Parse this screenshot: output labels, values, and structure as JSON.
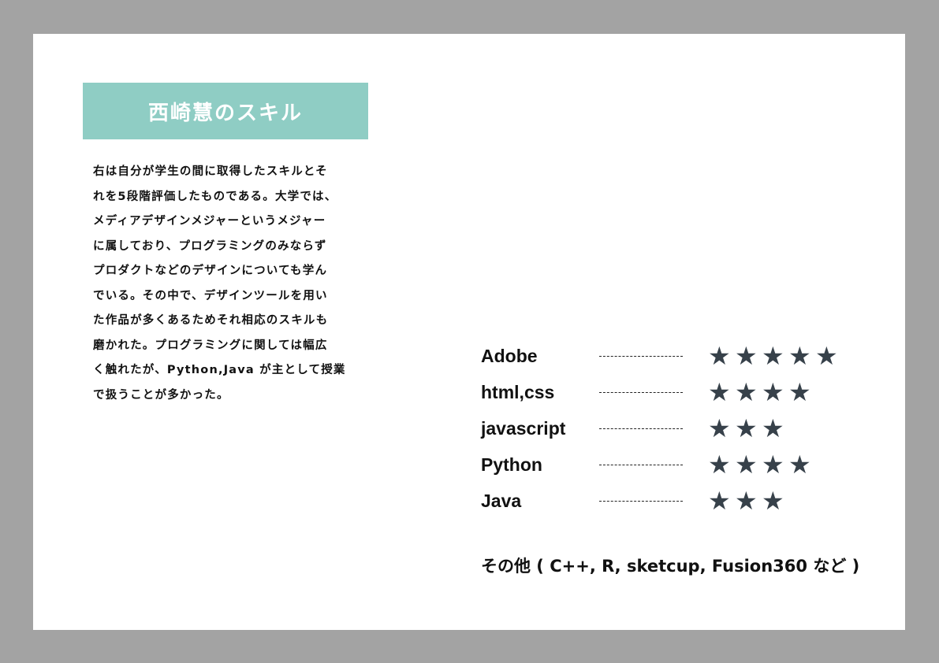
{
  "title": "西崎慧のスキル",
  "description_lines": [
    "右は自分が学生の間に取得したスキルとそ",
    "れを5段階評価したものである。大学では、",
    "メディアデザインメジャーというメジャー",
    "に属しており、プログラミングのみならず",
    "プロダクトなどのデザインについても学ん",
    "でいる。その中で、デザインツールを用い",
    "た作品が多くあるためそれ相応のスキルも",
    "磨かれた。プログラミングに関しては幅広",
    "く触れたが、Python,Java が主として授業",
    "で扱うことが多かった。"
  ],
  "skills": [
    {
      "name": "Adobe",
      "rating": 5,
      "max": 5
    },
    {
      "name": "html,css",
      "rating": 4,
      "max": 5
    },
    {
      "name": "javascript",
      "rating": 3,
      "max": 5
    },
    {
      "name": "Python",
      "rating": 4,
      "max": 5
    },
    {
      "name": "Java",
      "rating": 3,
      "max": 5
    }
  ],
  "other": "その他 ( C++, R, sketcup, Fusion360 など )",
  "colors": {
    "background": "#a3a3a3",
    "title_box": "#8fcdc4",
    "star": "#37414a"
  },
  "icons": {
    "rating": "star-icon"
  }
}
